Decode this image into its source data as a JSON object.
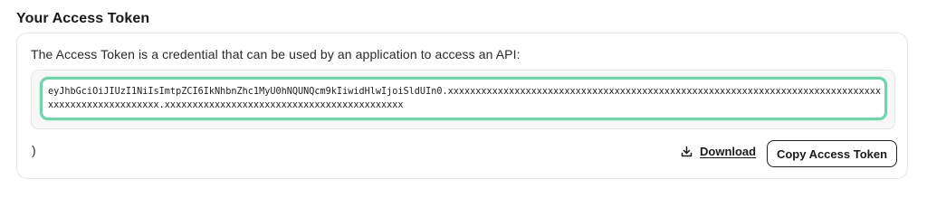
{
  "section": {
    "title": "Your Access Token"
  },
  "card": {
    "description": "The Access Token is a credential that can be used by an application to access an API:",
    "token": "eyJhbGciOiJIUzI1NiIsImtpZCI6IkNhbnZhc1MyU0hNQUNQcm9kIiwidHlwIjoiSldUIn0.xxxxxxxxxxxxxxxxxxxxxxxxxxxxxxxxxxxxxxxxxxxxxxxxxxxxxxxxxxxxxxxxxxxxxxxxxxxxxxxxxxxxxxxxxxxxxxxxxx.xxxxxxxxxxxxxxxxxxxxxxxxxxxxxxxxxxxxxxxxxxx",
    "trailing_text": ")"
  },
  "actions": {
    "download_label": "Download",
    "download_icon": "download-icon",
    "copy_label": "Copy Access Token"
  },
  "colors": {
    "token_focus_border": "#6fd3ac",
    "text": "#1a1a1a"
  }
}
